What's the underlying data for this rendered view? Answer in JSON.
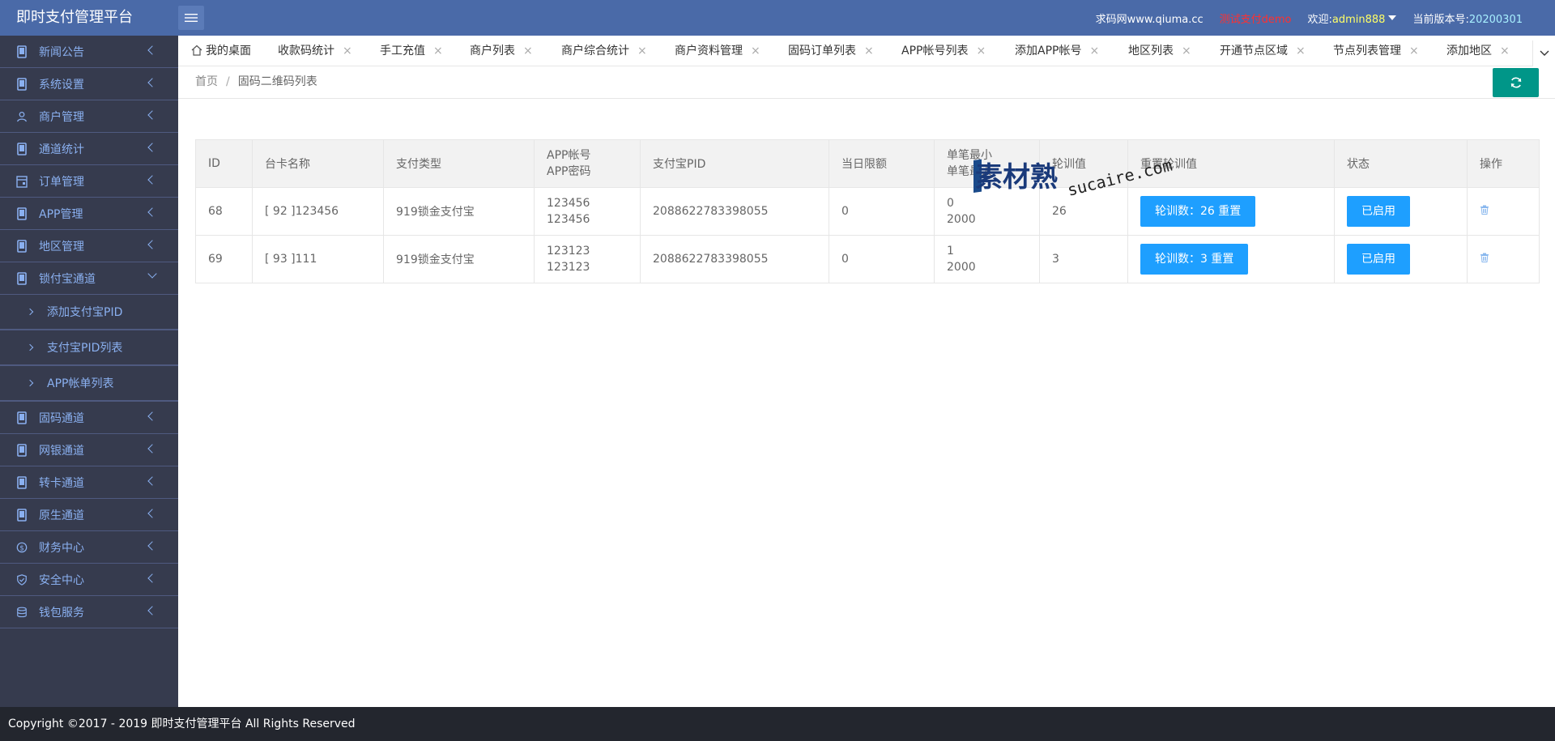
{
  "app_title": "即时支付管理平台",
  "header": {
    "site_link": "求码网www.qiuma.cc",
    "test_account": "测试支付demo",
    "welcome": "欢迎:",
    "username": "admin888",
    "version_label": "当前版本号:",
    "version": "20200301"
  },
  "sidebar": {
    "items": [
      {
        "label": "新闻公告",
        "icon": "phone-icon"
      },
      {
        "label": "系统设置",
        "icon": "phone-icon"
      },
      {
        "label": "商户管理",
        "icon": "user-icon"
      },
      {
        "label": "通道统计",
        "icon": "phone-icon"
      },
      {
        "label": "订单管理",
        "icon": "calendar-icon"
      },
      {
        "label": "APP管理",
        "icon": "phone-icon"
      },
      {
        "label": "地区管理",
        "icon": "phone-icon"
      },
      {
        "label": "锁付宝通道",
        "icon": "phone-icon",
        "expanded": true
      }
    ],
    "sub_items": [
      {
        "label": "添加支付宝PID"
      },
      {
        "label": "支付宝PID列表"
      },
      {
        "label": "APP帐单列表"
      }
    ],
    "items_after": [
      {
        "label": "固码通道",
        "icon": "phone-icon"
      },
      {
        "label": "网银通道",
        "icon": "phone-icon"
      },
      {
        "label": "转卡通道",
        "icon": "phone-icon"
      },
      {
        "label": "原生通道",
        "icon": "phone-icon"
      },
      {
        "label": "财务中心",
        "icon": "dollar-icon"
      },
      {
        "label": "安全中心",
        "icon": "shield-icon"
      },
      {
        "label": "钱包服务",
        "icon": "database-icon"
      }
    ]
  },
  "tabs": [
    {
      "label": "我的桌面",
      "closable": false
    },
    {
      "label": "收款码统计",
      "closable": true
    },
    {
      "label": "手工充值",
      "closable": true
    },
    {
      "label": "商户列表",
      "closable": true
    },
    {
      "label": "商户综合统计",
      "closable": true
    },
    {
      "label": "商户资料管理",
      "closable": true
    },
    {
      "label": "固码订单列表",
      "closable": true
    },
    {
      "label": "APP帐号列表",
      "closable": true
    },
    {
      "label": "添加APP帐号",
      "closable": true
    },
    {
      "label": "地区列表",
      "closable": true
    },
    {
      "label": "开通节点区域",
      "closable": true
    },
    {
      "label": "节点列表管理",
      "closable": true
    },
    {
      "label": "添加地区",
      "closable": true
    }
  ],
  "tab_close_glyph": "×",
  "breadcrumb": {
    "home": "首页",
    "separator": "/",
    "current": "固码二维码列表"
  },
  "table": {
    "headers": [
      {
        "l1": "ID"
      },
      {
        "l1": "台卡名称"
      },
      {
        "l1": "支付类型"
      },
      {
        "l1": "APP帐号",
        "l2": "APP密码"
      },
      {
        "l1": "支付宝PID"
      },
      {
        "l1": "当日限额"
      },
      {
        "l1": "单笔最小",
        "l2": "单笔最大"
      },
      {
        "l1": "轮训值"
      },
      {
        "l1": "重置轮训值"
      },
      {
        "l1": "状态"
      },
      {
        "l1": "操作"
      }
    ],
    "rows": [
      {
        "id": "68",
        "name": "[ 92 ]123456",
        "pay_type": "919锁金支付宝",
        "app_account": "123456",
        "app_password": "123456",
        "pid": "2088622783398055",
        "daily_limit": "0",
        "min": "0",
        "max": "2000",
        "poll": "26",
        "reset_label": "轮训数：26 重置",
        "status_label": "已启用"
      },
      {
        "id": "69",
        "name": "[ 93 ]111",
        "pay_type": "919锁金支付宝",
        "app_account": "123123",
        "app_password": "123123",
        "pid": "2088622783398055",
        "daily_limit": "0",
        "min": "1",
        "max": "2000",
        "poll": "3",
        "reset_label": "轮训数：3 重置",
        "status_label": "已启用"
      }
    ]
  },
  "watermark": {
    "text_cn": "素材熟",
    "text_en": "sucaire.com"
  },
  "footer": {
    "copyright": "Copyright ©2017 - 2019 即时支付管理平台 All Rights Reserved"
  },
  "colors": {
    "header_bg": "#4a6aa8",
    "sidebar_bg": "#363b4e",
    "primary_button": "#1e9fff",
    "refresh_button": "#009688",
    "footer_bg": "#23262e"
  }
}
